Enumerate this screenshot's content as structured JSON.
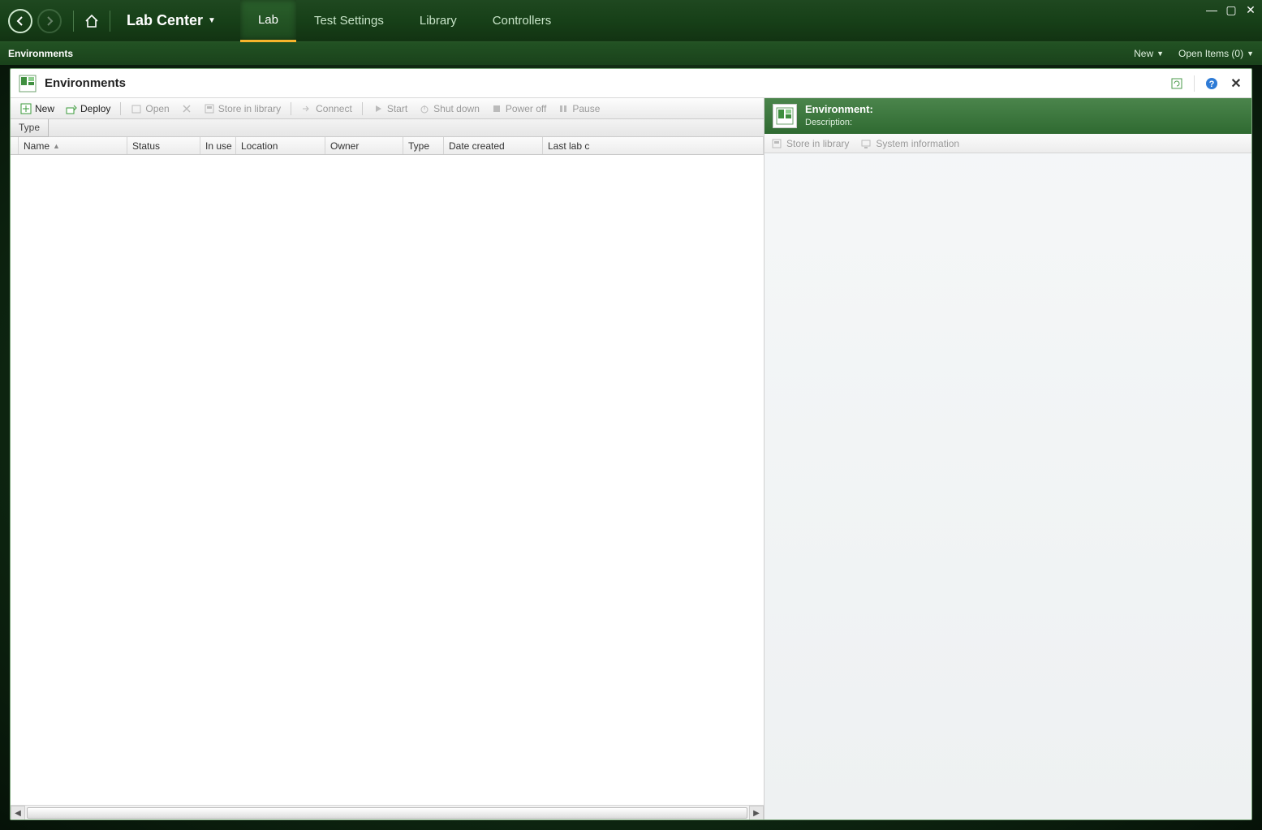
{
  "app": {
    "title": "Lab Center",
    "tabs": [
      "Lab",
      "Test Settings",
      "Library",
      "Controllers"
    ],
    "active_tab_index": 0
  },
  "subribbon": {
    "left_tab": "Environments",
    "new_label": "New",
    "open_items_label": "Open Items (0)"
  },
  "page": {
    "title": "Environments"
  },
  "toolbar": {
    "new": "New",
    "deploy": "Deploy",
    "open": "Open",
    "store": "Store in library",
    "connect": "Connect",
    "start": "Start",
    "shutdown": "Shut down",
    "poweroff": "Power off",
    "pause": "Pause"
  },
  "typerow_label": "Type",
  "columns": {
    "name": "Name",
    "status": "Status",
    "in_use": "In use",
    "location": "Location",
    "owner": "Owner",
    "type": "Type",
    "date_created": "Date created",
    "last_lab": "Last lab c"
  },
  "right": {
    "env_label": "Environment:",
    "desc_label": "Description:",
    "store": "Store in library",
    "sysinfo": "System information"
  }
}
